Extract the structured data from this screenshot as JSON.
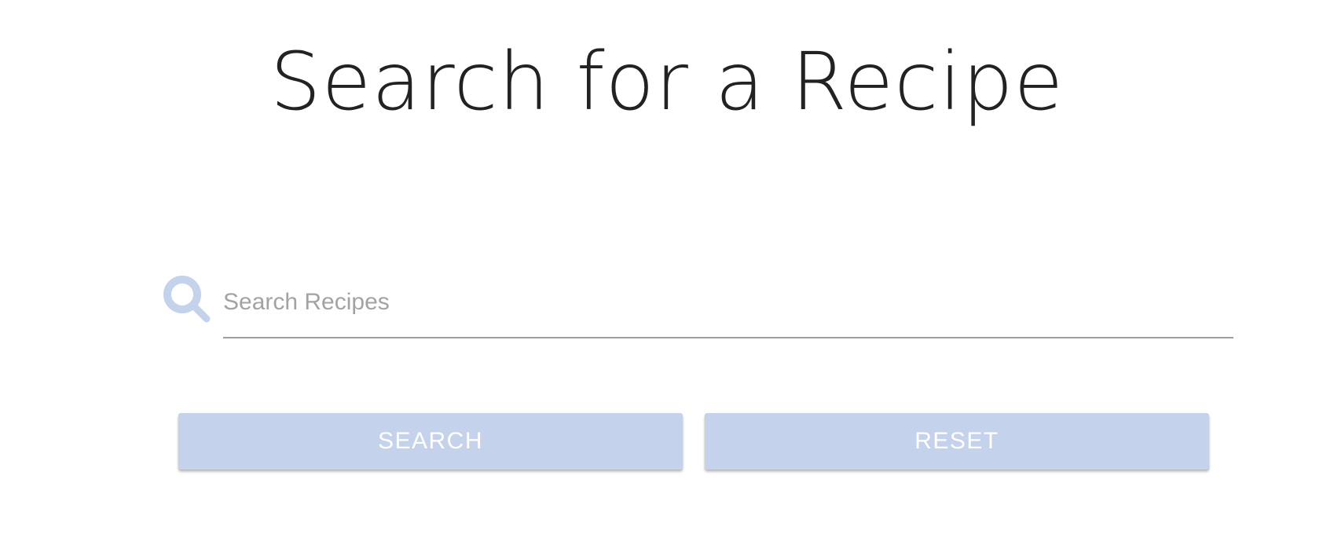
{
  "page": {
    "title": "Search for a Recipe"
  },
  "search": {
    "placeholder": "Search Recipes",
    "value": "",
    "icon": "search-icon"
  },
  "buttons": {
    "search_label": "SEARCH",
    "reset_label": "RESET"
  },
  "colors": {
    "accent": "#c5d2ec",
    "icon": "#c5d2ec",
    "title": "#222222",
    "placeholder": "#a3a3a3",
    "underline": "#9e9e9e"
  }
}
